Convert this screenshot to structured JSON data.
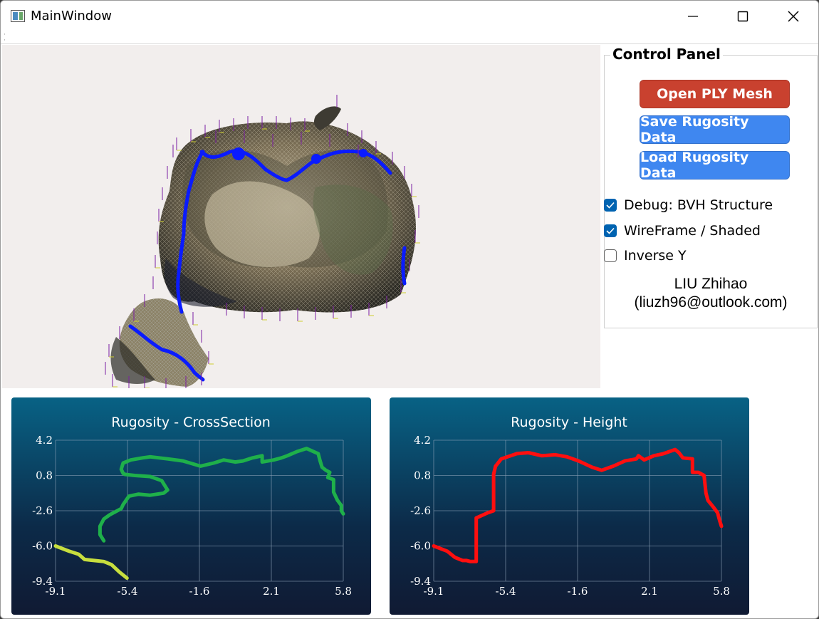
{
  "window": {
    "title": "MainWindow"
  },
  "control_panel": {
    "title": "Control Panel",
    "buttons": {
      "open": "Open PLY Mesh",
      "save": "Save Rugosity Data",
      "load": "Load Rugosity Data"
    },
    "checkboxes": [
      {
        "label": "Debug: BVH Structure",
        "checked": true
      },
      {
        "label": "WireFrame / Shaded",
        "checked": true
      },
      {
        "label": "Inverse Y",
        "checked": false
      }
    ],
    "author_name": "LIU Zhihao",
    "author_email": "(liuzh96@outlook.com)"
  },
  "colors": {
    "open_button": "#c9412f",
    "blue_button": "#3f87f0",
    "checkbox": "#0063b1"
  },
  "chart_data": [
    {
      "type": "line",
      "title": "Rugosity - CrossSection",
      "x_ticks": [
        "-9.1",
        "-5.4",
        "-1.6",
        "2.1",
        "5.8"
      ],
      "y_ticks": [
        "4.2",
        "0.8",
        "-2.6",
        "-6.0",
        "-9.4"
      ],
      "xlim": [
        -9.1,
        5.8
      ],
      "ylim": [
        -9.4,
        4.2
      ],
      "grid": true,
      "series": [
        {
          "color": "#1fb04a",
          "x": [
            5.8,
            5.7,
            5.7,
            5.5,
            5.3,
            5.3,
            5.0,
            5.1,
            4.9,
            4.7,
            4.6,
            4.5,
            3.9,
            3.4,
            2.9,
            2.6,
            2.2,
            1.6,
            1.6,
            1.1,
            0.6,
            0.2,
            -0.4,
            -0.9,
            -1.6,
            -2.5,
            -3.3,
            -4.2,
            -4.6,
            -5.2,
            -5.6,
            -5.7,
            -5.6,
            -5.5,
            -5.0,
            -4.2,
            -3.6,
            -3.3,
            -3.5,
            -4.2,
            -4.8,
            -5.3,
            -5.6,
            -5.7,
            -6.3,
            -6.6,
            -6.8,
            -6.8,
            -6.6
          ],
          "y": [
            -2.9,
            -2.6,
            -2.1,
            -1.6,
            -0.8,
            0.4,
            0.6,
            1.1,
            1.3,
            1.6,
            2.2,
            2.9,
            3.4,
            3.1,
            2.7,
            2.5,
            2.3,
            2.1,
            2.7,
            2.5,
            2.2,
            2.1,
            2.3,
            2.0,
            1.7,
            2.2,
            2.4,
            2.6,
            2.5,
            2.3,
            2.0,
            1.4,
            1.0,
            0.9,
            0.8,
            0.7,
            0.3,
            -0.6,
            -0.9,
            -1.1,
            -1.0,
            -1.2,
            -2.0,
            -2.4,
            -3.0,
            -3.4,
            -4.1,
            -4.9,
            -5.5
          ]
        },
        {
          "color": "#c7de3e",
          "x": [
            -9.1,
            -8.4,
            -7.9,
            -7.6,
            -7.1,
            -6.6,
            -6.2,
            -5.8,
            -5.4
          ],
          "y": [
            -6.0,
            -6.5,
            -6.8,
            -7.3,
            -7.4,
            -7.5,
            -7.8,
            -8.5,
            -9.1
          ]
        }
      ]
    },
    {
      "type": "line",
      "title": "Rugosity - Height",
      "x_ticks": [
        "-9.1",
        "-5.4",
        "-1.6",
        "2.1",
        "5.8"
      ],
      "y_ticks": [
        "4.2",
        "0.8",
        "-2.6",
        "-6.0",
        "-9.4"
      ],
      "xlim": [
        -9.1,
        5.8
      ],
      "ylim": [
        -9.4,
        4.2
      ],
      "grid": true,
      "series": [
        {
          "color": "#ff0f0f",
          "x": [
            -9.1,
            -8.4,
            -8.0,
            -7.6,
            -7.4,
            -7.2,
            -6.9,
            -6.9,
            -6.3,
            -6.0,
            -6.0,
            -5.9,
            -5.6,
            -4.8,
            -4.2,
            -3.5,
            -2.8,
            -2.2,
            -1.6,
            -0.9,
            -0.4,
            0.2,
            0.8,
            1.4,
            1.5,
            1.8,
            2.3,
            2.8,
            3.4,
            3.6,
            3.8,
            4.3,
            4.3,
            4.6,
            4.9,
            5.0,
            5.1,
            5.4,
            5.6,
            5.7,
            5.8
          ],
          "y": [
            -6.0,
            -6.5,
            -7.1,
            -7.4,
            -7.4,
            -7.5,
            -7.5,
            -3.3,
            -2.8,
            -2.6,
            0.9,
            1.7,
            2.4,
            2.9,
            3.0,
            2.7,
            2.8,
            2.6,
            2.2,
            1.6,
            1.3,
            1.7,
            2.2,
            2.4,
            2.7,
            2.3,
            2.7,
            2.9,
            3.3,
            3.0,
            2.5,
            2.4,
            1.1,
            1.1,
            0.8,
            -0.9,
            -1.6,
            -2.3,
            -2.8,
            -3.5,
            -4.1
          ]
        }
      ]
    }
  ]
}
